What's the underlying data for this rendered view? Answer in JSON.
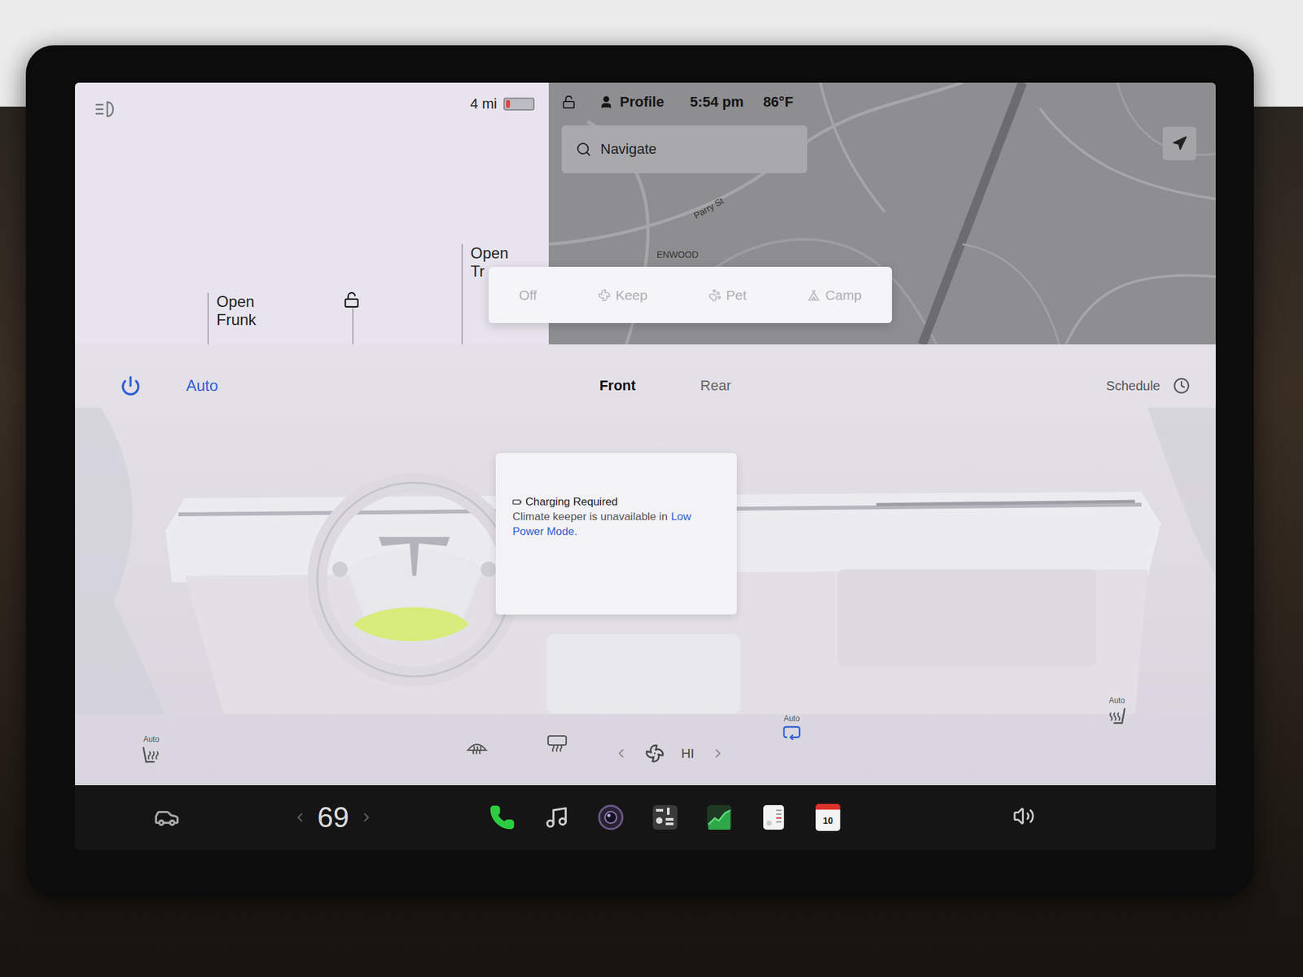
{
  "status_bar": {
    "range": "4 mi",
    "battery_level": 0.14,
    "locked": false,
    "profile": "Profile",
    "time": "5:54 pm",
    "temperature": "86°F"
  },
  "car_panel": {
    "door_locked": false,
    "frunk": {
      "line1": "Open",
      "line2": "Frunk"
    },
    "trunk": {
      "line1": "Open",
      "line2": "Tr"
    }
  },
  "map": {
    "search": {
      "placeholder": "Navigate"
    },
    "labels": [
      {
        "text": "Parry St"
      },
      {
        "text": "ENWOOD"
      }
    ]
  },
  "climate_keeper_menu": {
    "options": [
      {
        "label": "Off",
        "kind": "off",
        "selected": false,
        "disabled": true
      },
      {
        "label": "Keep",
        "kind": "keep",
        "selected": false,
        "disabled": true
      },
      {
        "label": "Pet",
        "kind": "pet",
        "selected": false,
        "disabled": true
      },
      {
        "label": "Camp",
        "kind": "camp",
        "selected": false,
        "disabled": true
      }
    ]
  },
  "climate": {
    "power_on": true,
    "mode": "Auto",
    "tabs": [
      {
        "label": "Front",
        "selected": true
      },
      {
        "label": "Rear",
        "selected": false
      }
    ],
    "schedule": "Schedule",
    "notice": {
      "title": "Charging Required",
      "message": "Climate keeper is unavailable in",
      "link": "Low Power Mode."
    },
    "fan": {
      "label": "HI"
    },
    "recirculate": {
      "label": "Auto",
      "on": true
    },
    "seat_heaters": [
      {
        "label": "Auto",
        "side": "left"
      },
      {
        "label": "Auto",
        "side": "right"
      }
    ]
  },
  "taskbar": {
    "temperature": "69",
    "apps": [
      {
        "kind": "phone"
      },
      {
        "kind": "music"
      },
      {
        "kind": "camera"
      },
      {
        "kind": "toybox"
      },
      {
        "kind": "stocks"
      },
      {
        "kind": "notes"
      },
      {
        "kind": "calendar",
        "label": "10"
      }
    ]
  }
}
